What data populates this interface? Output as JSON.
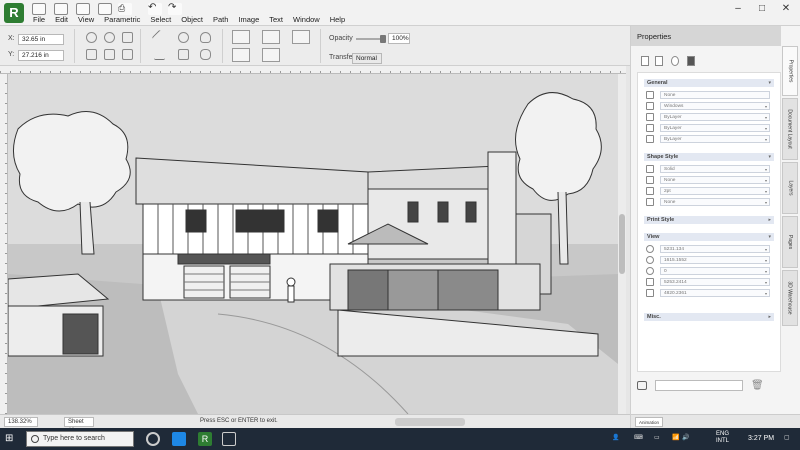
{
  "menu": [
    "File",
    "Edit",
    "View",
    "Parametric",
    "Select",
    "Object",
    "Path",
    "Image",
    "Text",
    "Window",
    "Help"
  ],
  "coords": {
    "x_label": "X:",
    "x_value": "32.65 in",
    "y_label": "Y:",
    "y_value": "27.216 in"
  },
  "toolbar": {
    "opacity_label": "Opacity",
    "opacity_value": "100%",
    "transfer_label": "Transfer",
    "transfer_value": "Normal"
  },
  "status": {
    "zoom": "138.32%",
    "sheet": "Sheet #1",
    "message": "Press ESC or ENTER to exit."
  },
  "properties": {
    "title": "Properties",
    "sections": {
      "general": "General",
      "shape_style": "Shape Style",
      "print_style": "Print Style",
      "view": "View",
      "misc": "Misc."
    },
    "general_fields": [
      "None",
      "Windows",
      "ByLayer",
      "ByLayer",
      "ByLayer"
    ],
    "shape_fields": [
      "Solid",
      "None",
      "2pt",
      "None"
    ],
    "view_fields": [
      "5231.134",
      "1615.1552",
      "0",
      "5253.2414",
      "4820.2361"
    ],
    "tabs": [
      "Properties",
      "Document Layout",
      "Layers",
      "Pages",
      "3D Warehouse"
    ],
    "footer_status": "Animation"
  },
  "taskbar": {
    "search_placeholder": "Type here to search",
    "lang_1": "ENG",
    "lang_2": "INTL",
    "time": "3:27 PM"
  },
  "colors": {
    "app_green": "#2e7d32",
    "taskbar": "#1f2a38",
    "section_header": "#e3e8f2"
  }
}
